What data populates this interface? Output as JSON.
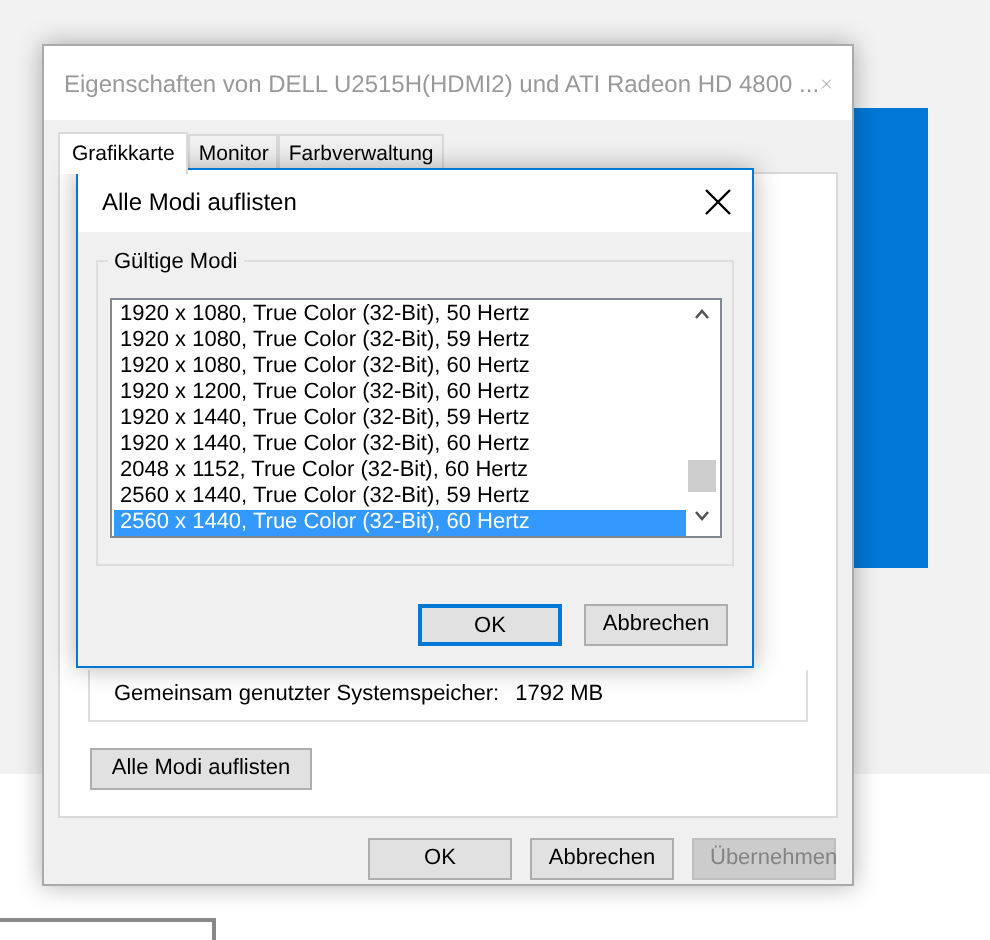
{
  "main_window": {
    "title": "Eigenschaften von DELL U2515H(HDMI2) und ATI Radeon HD 4800 ...",
    "tabs": [
      {
        "label": "Grafikkarte",
        "selected": true
      },
      {
        "label": "Monitor",
        "selected": false
      },
      {
        "label": "Farbverwaltung",
        "selected": false
      }
    ],
    "shared_memory": {
      "label": "Gemeinsam genutzter Systemspeicher:",
      "value": "1792 MB"
    },
    "list_all_button": "Alle Modi auflisten",
    "buttons": [
      {
        "label": "OK",
        "disabled": false
      },
      {
        "label": "Abbrechen",
        "disabled": false
      },
      {
        "label": "Übernehmen",
        "disabled": true
      }
    ]
  },
  "modal": {
    "title": "Alle Modi auflisten",
    "group_label": "Gültige Modi",
    "modes": [
      {
        "text": "1920 x 1080, True Color (32-Bit), 50 Hertz",
        "selected": false
      },
      {
        "text": "1920 x 1080, True Color (32-Bit), 59 Hertz",
        "selected": false
      },
      {
        "text": "1920 x 1080, True Color (32-Bit), 60 Hertz",
        "selected": false
      },
      {
        "text": "1920 x 1200, True Color (32-Bit), 60 Hertz",
        "selected": false
      },
      {
        "text": "1920 x 1440, True Color (32-Bit), 59 Hertz",
        "selected": false
      },
      {
        "text": "1920 x 1440, True Color (32-Bit), 60 Hertz",
        "selected": false
      },
      {
        "text": "2048 x 1152, True Color (32-Bit), 60 Hertz",
        "selected": false
      },
      {
        "text": "2560 x 1440, True Color (32-Bit), 59 Hertz",
        "selected": false
      },
      {
        "text": "2560 x 1440, True Color (32-Bit), 60 Hertz",
        "selected": true
      }
    ],
    "buttons": [
      {
        "label": "OK",
        "default": true
      },
      {
        "label": "Abbrechen",
        "default": false
      }
    ]
  }
}
